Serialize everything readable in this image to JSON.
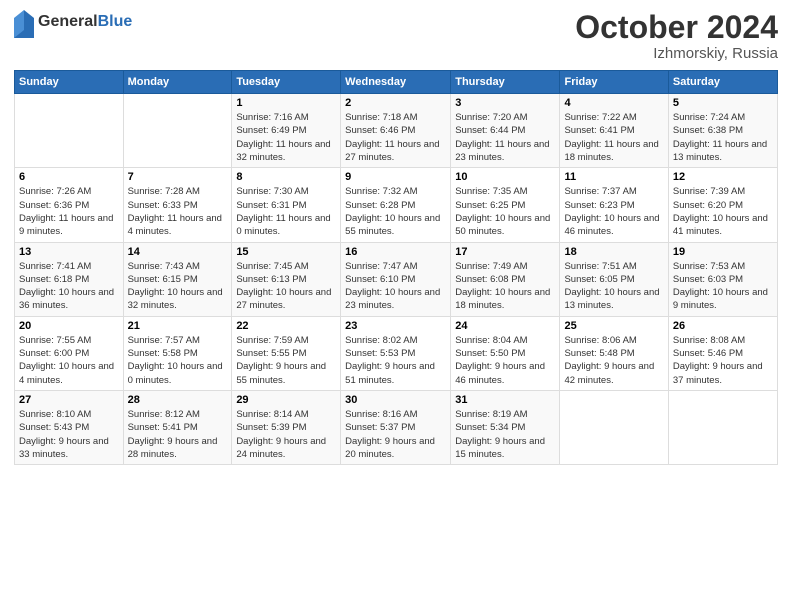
{
  "logo": {
    "general": "General",
    "blue": "Blue"
  },
  "header": {
    "title": "October 2024",
    "subtitle": "Izhmorskiy, Russia"
  },
  "days_of_week": [
    "Sunday",
    "Monday",
    "Tuesday",
    "Wednesday",
    "Thursday",
    "Friday",
    "Saturday"
  ],
  "weeks": [
    [
      {
        "day": "",
        "sunrise": "",
        "sunset": "",
        "daylight": ""
      },
      {
        "day": "",
        "sunrise": "",
        "sunset": "",
        "daylight": ""
      },
      {
        "day": "1",
        "sunrise": "Sunrise: 7:16 AM",
        "sunset": "Sunset: 6:49 PM",
        "daylight": "Daylight: 11 hours and 32 minutes."
      },
      {
        "day": "2",
        "sunrise": "Sunrise: 7:18 AM",
        "sunset": "Sunset: 6:46 PM",
        "daylight": "Daylight: 11 hours and 27 minutes."
      },
      {
        "day": "3",
        "sunrise": "Sunrise: 7:20 AM",
        "sunset": "Sunset: 6:44 PM",
        "daylight": "Daylight: 11 hours and 23 minutes."
      },
      {
        "day": "4",
        "sunrise": "Sunrise: 7:22 AM",
        "sunset": "Sunset: 6:41 PM",
        "daylight": "Daylight: 11 hours and 18 minutes."
      },
      {
        "day": "5",
        "sunrise": "Sunrise: 7:24 AM",
        "sunset": "Sunset: 6:38 PM",
        "daylight": "Daylight: 11 hours and 13 minutes."
      }
    ],
    [
      {
        "day": "6",
        "sunrise": "Sunrise: 7:26 AM",
        "sunset": "Sunset: 6:36 PM",
        "daylight": "Daylight: 11 hours and 9 minutes."
      },
      {
        "day": "7",
        "sunrise": "Sunrise: 7:28 AM",
        "sunset": "Sunset: 6:33 PM",
        "daylight": "Daylight: 11 hours and 4 minutes."
      },
      {
        "day": "8",
        "sunrise": "Sunrise: 7:30 AM",
        "sunset": "Sunset: 6:31 PM",
        "daylight": "Daylight: 11 hours and 0 minutes."
      },
      {
        "day": "9",
        "sunrise": "Sunrise: 7:32 AM",
        "sunset": "Sunset: 6:28 PM",
        "daylight": "Daylight: 10 hours and 55 minutes."
      },
      {
        "day": "10",
        "sunrise": "Sunrise: 7:35 AM",
        "sunset": "Sunset: 6:25 PM",
        "daylight": "Daylight: 10 hours and 50 minutes."
      },
      {
        "day": "11",
        "sunrise": "Sunrise: 7:37 AM",
        "sunset": "Sunset: 6:23 PM",
        "daylight": "Daylight: 10 hours and 46 minutes."
      },
      {
        "day": "12",
        "sunrise": "Sunrise: 7:39 AM",
        "sunset": "Sunset: 6:20 PM",
        "daylight": "Daylight: 10 hours and 41 minutes."
      }
    ],
    [
      {
        "day": "13",
        "sunrise": "Sunrise: 7:41 AM",
        "sunset": "Sunset: 6:18 PM",
        "daylight": "Daylight: 10 hours and 36 minutes."
      },
      {
        "day": "14",
        "sunrise": "Sunrise: 7:43 AM",
        "sunset": "Sunset: 6:15 PM",
        "daylight": "Daylight: 10 hours and 32 minutes."
      },
      {
        "day": "15",
        "sunrise": "Sunrise: 7:45 AM",
        "sunset": "Sunset: 6:13 PM",
        "daylight": "Daylight: 10 hours and 27 minutes."
      },
      {
        "day": "16",
        "sunrise": "Sunrise: 7:47 AM",
        "sunset": "Sunset: 6:10 PM",
        "daylight": "Daylight: 10 hours and 23 minutes."
      },
      {
        "day": "17",
        "sunrise": "Sunrise: 7:49 AM",
        "sunset": "Sunset: 6:08 PM",
        "daylight": "Daylight: 10 hours and 18 minutes."
      },
      {
        "day": "18",
        "sunrise": "Sunrise: 7:51 AM",
        "sunset": "Sunset: 6:05 PM",
        "daylight": "Daylight: 10 hours and 13 minutes."
      },
      {
        "day": "19",
        "sunrise": "Sunrise: 7:53 AM",
        "sunset": "Sunset: 6:03 PM",
        "daylight": "Daylight: 10 hours and 9 minutes."
      }
    ],
    [
      {
        "day": "20",
        "sunrise": "Sunrise: 7:55 AM",
        "sunset": "Sunset: 6:00 PM",
        "daylight": "Daylight: 10 hours and 4 minutes."
      },
      {
        "day": "21",
        "sunrise": "Sunrise: 7:57 AM",
        "sunset": "Sunset: 5:58 PM",
        "daylight": "Daylight: 10 hours and 0 minutes."
      },
      {
        "day": "22",
        "sunrise": "Sunrise: 7:59 AM",
        "sunset": "Sunset: 5:55 PM",
        "daylight": "Daylight: 9 hours and 55 minutes."
      },
      {
        "day": "23",
        "sunrise": "Sunrise: 8:02 AM",
        "sunset": "Sunset: 5:53 PM",
        "daylight": "Daylight: 9 hours and 51 minutes."
      },
      {
        "day": "24",
        "sunrise": "Sunrise: 8:04 AM",
        "sunset": "Sunset: 5:50 PM",
        "daylight": "Daylight: 9 hours and 46 minutes."
      },
      {
        "day": "25",
        "sunrise": "Sunrise: 8:06 AM",
        "sunset": "Sunset: 5:48 PM",
        "daylight": "Daylight: 9 hours and 42 minutes."
      },
      {
        "day": "26",
        "sunrise": "Sunrise: 8:08 AM",
        "sunset": "Sunset: 5:46 PM",
        "daylight": "Daylight: 9 hours and 37 minutes."
      }
    ],
    [
      {
        "day": "27",
        "sunrise": "Sunrise: 8:10 AM",
        "sunset": "Sunset: 5:43 PM",
        "daylight": "Daylight: 9 hours and 33 minutes."
      },
      {
        "day": "28",
        "sunrise": "Sunrise: 8:12 AM",
        "sunset": "Sunset: 5:41 PM",
        "daylight": "Daylight: 9 hours and 28 minutes."
      },
      {
        "day": "29",
        "sunrise": "Sunrise: 8:14 AM",
        "sunset": "Sunset: 5:39 PM",
        "daylight": "Daylight: 9 hours and 24 minutes."
      },
      {
        "day": "30",
        "sunrise": "Sunrise: 8:16 AM",
        "sunset": "Sunset: 5:37 PM",
        "daylight": "Daylight: 9 hours and 20 minutes."
      },
      {
        "day": "31",
        "sunrise": "Sunrise: 8:19 AM",
        "sunset": "Sunset: 5:34 PM",
        "daylight": "Daylight: 9 hours and 15 minutes."
      },
      {
        "day": "",
        "sunrise": "",
        "sunset": "",
        "daylight": ""
      },
      {
        "day": "",
        "sunrise": "",
        "sunset": "",
        "daylight": ""
      }
    ]
  ]
}
